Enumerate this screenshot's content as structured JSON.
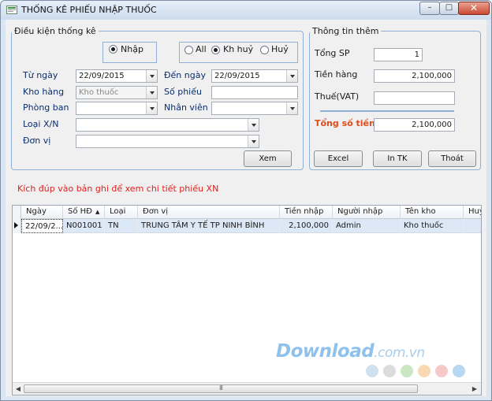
{
  "window": {
    "title": "THỐNG KÊ PHIẾU NHẬP THUỐC",
    "min": "–",
    "max": "□",
    "close": "✕"
  },
  "filters": {
    "legend": "Điều kiện thống kê",
    "type_radio": "Nhập",
    "status_radios": [
      "All",
      "Kh huỷ",
      "Huỷ"
    ],
    "status_selected": "Kh huỷ",
    "from_date_label": "Từ ngày",
    "from_date": "22/09/2015",
    "to_date_label": "Đến ngày",
    "to_date": "22/09/2015",
    "warehouse_label": "Kho hàng",
    "warehouse": "Kho thuốc",
    "voucher_no_label": "Số phiếu",
    "voucher_no": "",
    "department_label": "Phòng ban",
    "department": "",
    "staff_label": "Nhân viên",
    "staff": "",
    "xn_type_label": "Loại X/N",
    "xn_type": "",
    "unit_label": "Đơn vị",
    "unit": "",
    "view_button": "Xem"
  },
  "info": {
    "legend": "Thông tin thêm",
    "total_sp_label": "Tổng SP",
    "total_sp": "1",
    "goods_amount_label": "Tiền hàng",
    "goods_amount": "2,100,000",
    "vat_label": "Thuế(VAT)",
    "vat": "",
    "total_label": "Tổng số tiền",
    "total": "2,100,000",
    "excel_button": "Excel",
    "print_button": "In TK",
    "exit_button": "Thoát"
  },
  "hint": "Kích đúp vào bản ghi để xem chi tiết phiếu XN",
  "table": {
    "columns": [
      "Ngày",
      "Số HĐ",
      "Loại",
      "Đơn vị",
      "Tiền nhập",
      "Người nhập",
      "Tên kho",
      "Huỷ"
    ],
    "sort_column": "Số HĐ",
    "rows": [
      [
        "22/09/2...",
        "N001001",
        "TN",
        "TRUNG TÂM Y TẾ TP NINH BÌNH",
        "2,100,000",
        "Admin",
        "Kho thuốc",
        ""
      ]
    ],
    "scroll_center": "III"
  },
  "watermark": {
    "brand": "Download",
    "suffix": ".com.vn"
  },
  "colors": {
    "label_blue": "#0a2d6e",
    "total_label": "#e24a1a",
    "hint_red": "#e0201d",
    "dots": [
      "#cfe0ef",
      "#dcdcdc",
      "#c9e7c3",
      "#f8d9b3",
      "#f6c9c9",
      "#b7d8f2"
    ]
  }
}
